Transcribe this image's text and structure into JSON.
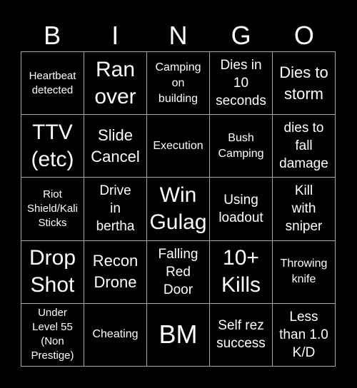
{
  "header": {
    "letters": [
      "B",
      "I",
      "N",
      "G",
      "O"
    ]
  },
  "cells": [
    {
      "text": "Heartbeat\ndetected",
      "size": "s0"
    },
    {
      "text": "Ran\nover",
      "size": "s4"
    },
    {
      "text": "Camping\non\nbuilding",
      "size": "s15"
    },
    {
      "text": "Dies in\n10\nseconds",
      "size": "s2"
    },
    {
      "text": "Dies to\nstorm",
      "size": "s3"
    },
    {
      "text": "TTV\n(etc)",
      "size": "s4"
    },
    {
      "text": "Slide\nCancel",
      "size": "s3"
    },
    {
      "text": "Execution",
      "size": "s15"
    },
    {
      "text": "Bush\nCamping",
      "size": "s15"
    },
    {
      "text": "dies to\nfall\ndamage",
      "size": "s2"
    },
    {
      "text": "Riot\nShield/Kali\nSticks",
      "size": "s0"
    },
    {
      "text": "Drive\nin\nbertha",
      "size": "s2"
    },
    {
      "text": "Win\nGulag",
      "size": "s4"
    },
    {
      "text": "Using\nloadout",
      "size": "s2"
    },
    {
      "text": "Kill\nwith\nsniper",
      "size": "s2"
    },
    {
      "text": "Drop\nShot",
      "size": "s4"
    },
    {
      "text": "Recon\nDrone",
      "size": "s3"
    },
    {
      "text": "Falling\nRed\nDoor",
      "size": "s2"
    },
    {
      "text": "10+\nKills",
      "size": "s4"
    },
    {
      "text": "Throwing\nknife",
      "size": "s15"
    },
    {
      "text": "Under\nLevel 55\n(Non\nPrestige)",
      "size": "s0"
    },
    {
      "text": "Cheating",
      "size": "s15"
    },
    {
      "text": "BM",
      "size": "s5"
    },
    {
      "text": "Self rez\nsuccess",
      "size": "s2"
    },
    {
      "text": "Less\nthan 1.0\nK/D",
      "size": "s2"
    }
  ]
}
